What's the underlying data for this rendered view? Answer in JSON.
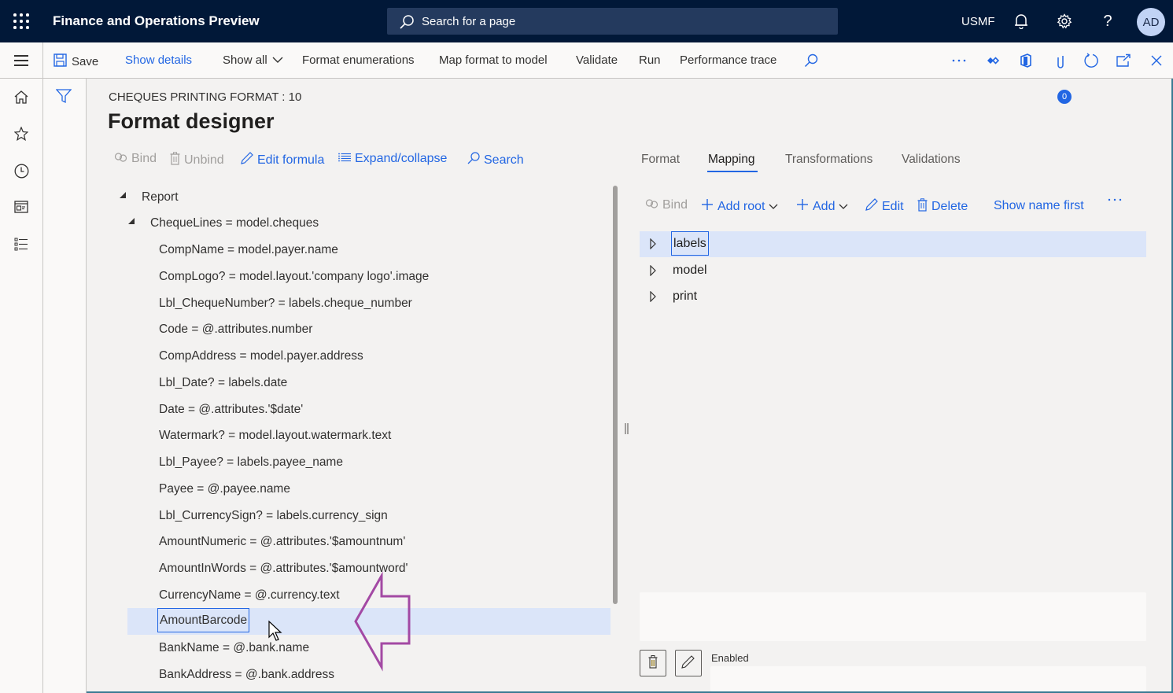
{
  "topbar": {
    "app_title": "Finance and Operations Preview",
    "search_placeholder": "Search for a page",
    "company": "USMF",
    "avatar_initials": "AD"
  },
  "actionbar": {
    "save": "Save",
    "show_details": "Show details",
    "show_all": "Show all",
    "format_enumerations": "Format enumerations",
    "map_format_to_model": "Map format to model",
    "validate": "Validate",
    "run": "Run",
    "performance_trace": "Performance trace",
    "attachments_count": "0"
  },
  "page": {
    "caption": "CHEQUES PRINTING FORMAT : 10",
    "title": "Format designer"
  },
  "format_toolbar": {
    "bind": "Bind",
    "unbind": "Unbind",
    "edit_formula": "Edit formula",
    "expand_collapse": "Expand/collapse",
    "search": "Search"
  },
  "format_tree": [
    {
      "label": "Report",
      "level": 0,
      "expanded": true
    },
    {
      "label": "ChequeLines = model.cheques",
      "level": 1,
      "expanded": true
    },
    {
      "label": "CompName = model.payer.name",
      "level": 2
    },
    {
      "label": "CompLogo? = model.layout.'company logo'.image",
      "level": 2
    },
    {
      "label": "Lbl_ChequeNumber? = labels.cheque_number",
      "level": 2
    },
    {
      "label": "Code = @.attributes.number",
      "level": 2
    },
    {
      "label": "CompAddress = model.payer.address",
      "level": 2
    },
    {
      "label": "Lbl_Date? = labels.date",
      "level": 2
    },
    {
      "label": "Date = @.attributes.'$date'",
      "level": 2
    },
    {
      "label": "Watermark? = model.layout.watermark.text",
      "level": 2
    },
    {
      "label": "Lbl_Payee? = labels.payee_name",
      "level": 2
    },
    {
      "label": "Payee = @.payee.name",
      "level": 2
    },
    {
      "label": "Lbl_CurrencySign? = labels.currency_sign",
      "level": 2
    },
    {
      "label": "AmountNumeric = @.attributes.'$amountnum'",
      "level": 2
    },
    {
      "label": "AmountInWords = @.attributes.'$amountword'",
      "level": 2
    },
    {
      "label": "CurrencyName = @.currency.text",
      "level": 2
    },
    {
      "label": "AmountBarcode",
      "level": 2,
      "selected": true
    },
    {
      "label": "BankName = @.bank.name",
      "level": 2
    },
    {
      "label": "BankAddress = @.bank.address",
      "level": 2
    }
  ],
  "tabs": [
    {
      "label": "Format"
    },
    {
      "label": "Mapping",
      "active": true
    },
    {
      "label": "Transformations"
    },
    {
      "label": "Validations"
    }
  ],
  "mapping_toolbar": {
    "bind": "Bind",
    "add_root": "Add root",
    "add": "Add",
    "edit": "Edit",
    "delete": "Delete",
    "show_name_first": "Show name first"
  },
  "data_sources": [
    {
      "label": "labels",
      "selected": true
    },
    {
      "label": "model"
    },
    {
      "label": "print"
    }
  ],
  "details": {
    "enabled_label": "Enabled",
    "enabled_value": ""
  },
  "colors": {
    "accent": "#2266e3",
    "topbar": "#011838",
    "selection": "#dbe5f9",
    "annotation_arrow": "#a349a4"
  }
}
